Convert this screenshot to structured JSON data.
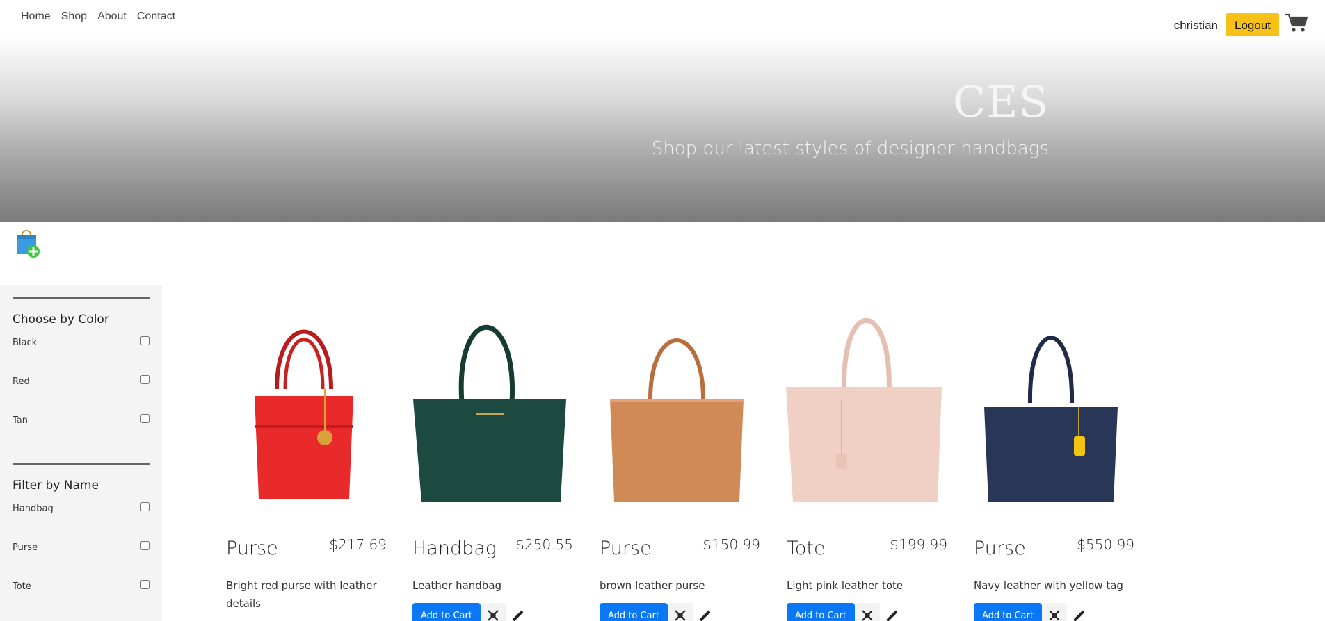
{
  "nav": {
    "links": [
      "Home",
      "Shop",
      "About",
      "Contact"
    ],
    "username": "christian",
    "logout_label": "Logout"
  },
  "hero": {
    "title": "CES",
    "subtitle": "Shop our latest styles of designer handbags"
  },
  "sidebar": {
    "color_heading": "Choose by Color",
    "colors": [
      "Black",
      "Red",
      "Tan"
    ],
    "name_heading": "Filter by Name",
    "names": [
      "Handbag",
      "Purse",
      "Tote"
    ]
  },
  "products": [
    {
      "name": "Purse",
      "price": "$217.69",
      "description": "Bright red purse with leather details",
      "color": "#e82a2a",
      "add_label": "Add to Cart"
    },
    {
      "name": "Handbag",
      "price": "$250.55",
      "description": "Leather handbag",
      "color": "#1d4a40",
      "add_label": "Add to Cart"
    },
    {
      "name": "Purse",
      "price": "$150.99",
      "description": "brown leather purse",
      "color": "#cf8a55",
      "add_label": "Add to Cart"
    },
    {
      "name": "Tote",
      "price": "$199.99",
      "description": "Light pink leather tote",
      "color": "#f0cfc4",
      "add_label": "Add to Cart"
    },
    {
      "name": "Purse",
      "price": "$550.99",
      "description": "Navy leather with yellow tag",
      "color": "#283657",
      "add_label": "Add to Cart"
    }
  ],
  "colors": {
    "accent_button": "#0a78f5",
    "logout_button": "#f8c118",
    "sidebar_bg": "#f4f4f4"
  }
}
